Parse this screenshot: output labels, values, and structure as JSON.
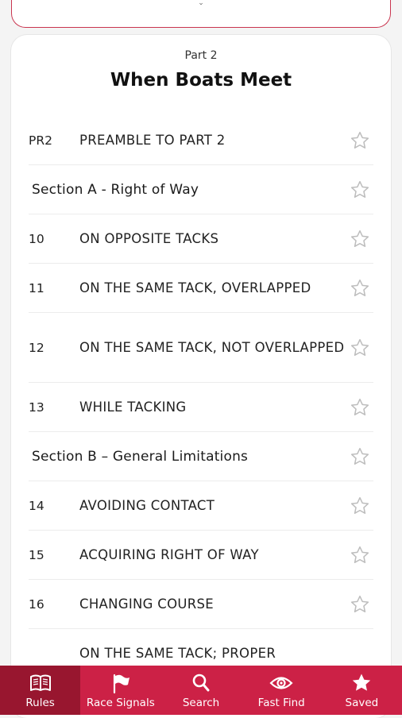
{
  "part": {
    "label": "Part 2",
    "title": "When Boats Meet"
  },
  "rules": [
    {
      "num": "PR2",
      "title": "PREAMBLE TO PART 2",
      "type": "rule",
      "icon": "star-outline-icon"
    },
    {
      "num": "",
      "title": "Section A - Right of Way",
      "type": "section",
      "icon": "star-outline-icon"
    },
    {
      "num": "10",
      "title": "ON OPPOSITE TACKS",
      "type": "rule",
      "icon": "star-outline-icon"
    },
    {
      "num": "11",
      "title": "ON THE SAME TACK, OVERLAPPED",
      "type": "rule",
      "icon": "star-outline-icon"
    },
    {
      "num": "12",
      "title": "ON THE SAME TACK, NOT OVERLAPPED",
      "type": "rule",
      "icon": "star-outline-icon"
    },
    {
      "num": "13",
      "title": "WHILE TACKING",
      "type": "rule",
      "icon": "star-outline-icon"
    },
    {
      "num": "",
      "title": "Section B – General Limitations",
      "type": "section",
      "icon": "star-outline-icon"
    },
    {
      "num": "14",
      "title": "AVOIDING CONTACT",
      "type": "rule",
      "icon": "star-outline-icon"
    },
    {
      "num": "15",
      "title": "ACQUIRING RIGHT OF WAY",
      "type": "rule",
      "icon": "star-outline-icon"
    },
    {
      "num": "16",
      "title": "CHANGING COURSE",
      "type": "rule",
      "icon": "star-outline-icon"
    },
    {
      "num": "",
      "title": "ON THE SAME TACK; PROPER",
      "type": "rule",
      "icon": "star-outline-icon"
    }
  ],
  "nav": [
    {
      "label": "Rules",
      "icon": "book-icon",
      "active": true
    },
    {
      "label": "Race Signals",
      "icon": "flag-icon",
      "active": false
    },
    {
      "label": "Search",
      "icon": "search-icon",
      "active": false
    },
    {
      "label": "Fast Find",
      "icon": "eye-icon",
      "active": false
    },
    {
      "label": "Saved",
      "icon": "star-icon",
      "active": false
    }
  ],
  "colors": {
    "accent": "#cc2146",
    "accent_active": "#98162f",
    "star_outline": "#bdbdbd"
  }
}
